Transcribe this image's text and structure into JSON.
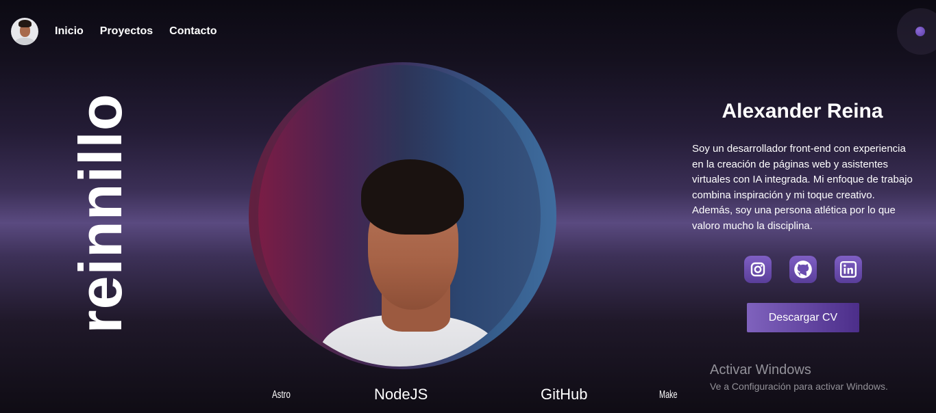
{
  "nav": {
    "links": [
      {
        "label": "Inicio"
      },
      {
        "label": "Proyectos"
      },
      {
        "label": "Contacto"
      }
    ]
  },
  "brand": {
    "vertical_text": "reinnillo"
  },
  "profile": {
    "name": "Alexander Reina",
    "bio": "Soy un desarrollador front-end con experiencia en la creación de páginas web y asistentes virtuales con IA integrada. Mi enfoque de trabajo combina inspiración y mi toque creativo. Además, soy una persona atlética por lo que valoro mucho la disciplina."
  },
  "social": [
    {
      "icon": "instagram-icon"
    },
    {
      "icon": "github-icon"
    },
    {
      "icon": "linkedin-icon"
    }
  ],
  "cv_button": {
    "label": "Descargar CV"
  },
  "tech": [
    "Astro",
    "NodeJS",
    "GitHub",
    "Make"
  ],
  "watermark": {
    "title": "Activar Windows",
    "subtitle": "Ve a Configuración para activar Windows."
  },
  "colors": {
    "accent": "#6b4fae",
    "button_start": "#7f62bd",
    "button_end": "#4c2e8a"
  }
}
